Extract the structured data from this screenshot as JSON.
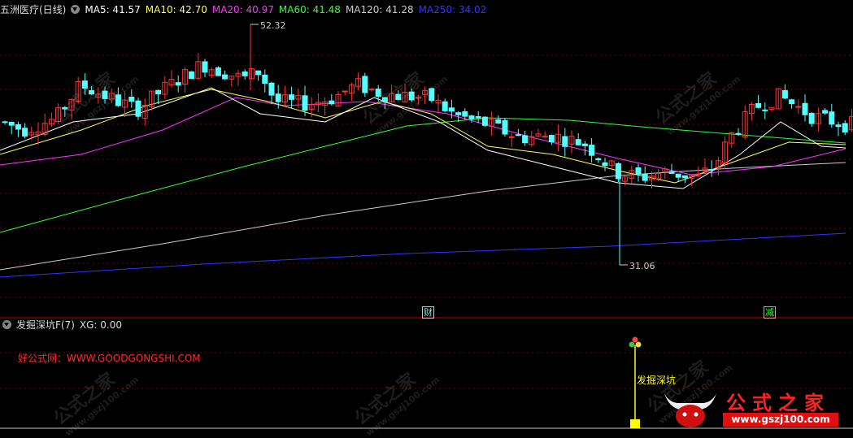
{
  "header": {
    "stock_title": "五洲医疗(日线)",
    "ma": [
      {
        "label": "MA5: 41.57",
        "color": "#ffffff"
      },
      {
        "label": "MA10: 42.70",
        "color": "#ffff55"
      },
      {
        "label": "MA20: 40.97",
        "color": "#ff33ff"
      },
      {
        "label": "MA60: 41.48",
        "color": "#33ff33"
      },
      {
        "label": "MA120: 41.28",
        "color": "#cccccc"
      },
      {
        "label": "MA250: 34.02",
        "color": "#3333ff"
      }
    ]
  },
  "price_chart": {
    "high_label": "52.32",
    "low_label": "31.06",
    "y_range": [
      28,
      55
    ],
    "up_color": "#ff3232",
    "down_color": "#54ffff"
  },
  "markers": [
    {
      "text": "财",
      "color": "#54ffff"
    },
    {
      "text": "减",
      "color": "#33ff33"
    }
  ],
  "indicator": {
    "title": "发掘深坑F(7)",
    "xg_label": "XG: 0.00",
    "signal_label": "发掘深坑"
  },
  "site_text": "好公式网：WWW.GOODGONGSHI.COM",
  "brand": {
    "title": "公式之家",
    "url": "www.gszj100.com"
  },
  "watermark": {
    "text": "公式之家",
    "url": "www.gszj100.com"
  },
  "colors": {
    "background": "#000000",
    "grid": "#7a0000",
    "signal": "#ffff00"
  }
}
